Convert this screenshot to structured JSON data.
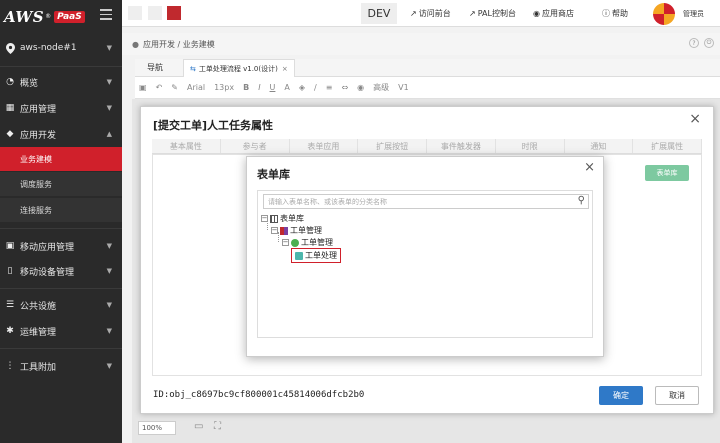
{
  "brand": {
    "name": "AWS",
    "reg": "®",
    "tag": "PaaS"
  },
  "sidebar": {
    "node": "aws-node#1",
    "items": [
      {
        "label": "概览",
        "icon": "dashboard-icon"
      },
      {
        "label": "应用管理",
        "icon": "app-grid-icon"
      },
      {
        "label": "应用开发",
        "icon": "cube-icon"
      },
      {
        "label": "移动应用管理",
        "icon": "mobile-apps-icon"
      },
      {
        "label": "移动设备管理",
        "icon": "phone-icon"
      },
      {
        "label": "公共设施",
        "icon": "list-icon"
      },
      {
        "label": "运维管理",
        "icon": "gear-icon"
      },
      {
        "label": "工具附加",
        "icon": "more-icon"
      }
    ],
    "sub_items": [
      {
        "label": "业务建模",
        "active": true
      },
      {
        "label": "调度服务",
        "active": false
      },
      {
        "label": "连接服务",
        "active": false
      }
    ]
  },
  "topbar": {
    "env": "DEV",
    "links": [
      {
        "label": "访问前台",
        "icon": "arrow-out-icon"
      },
      {
        "label": "PAL控制台",
        "icon": "arrow-out-icon"
      },
      {
        "label": "应用商店",
        "icon": "store-icon"
      },
      {
        "label": "帮助",
        "icon": "help-icon"
      }
    ],
    "user": "管理员",
    "accent": "#d0202b"
  },
  "breadcrumb": {
    "path": "应用开发 / 业务建模"
  },
  "tabs": {
    "nav": "导航",
    "active": "工单处理流程 v1.0(设计)"
  },
  "toolbar": {
    "font": "Arial",
    "size": "13px",
    "mode": "高级",
    "version": "V1"
  },
  "canvas": {
    "zoom": "100%"
  },
  "dialog": {
    "title": "[提交工单]人工任务属性",
    "tabs": [
      "基本属性",
      "参与者",
      "表单应用",
      "扩展按钮",
      "事件触发器",
      "时限",
      "通知",
      "扩展属性"
    ],
    "form_lib_button": "表单库",
    "id_text": "ID:obj_c8697bc9cf800001c45814006dfcb2b0",
    "ok": "确定",
    "cancel": "取消"
  },
  "modal": {
    "title": "表单库",
    "search_placeholder": "请输入表单名称、或该表单的分类名称",
    "tree": [
      {
        "label": "表单库",
        "level": 0
      },
      {
        "label": "工单管理",
        "level": 1
      },
      {
        "label": "工单管理",
        "level": 2
      },
      {
        "label": "工单处理",
        "level": 3,
        "selected": true
      }
    ]
  }
}
